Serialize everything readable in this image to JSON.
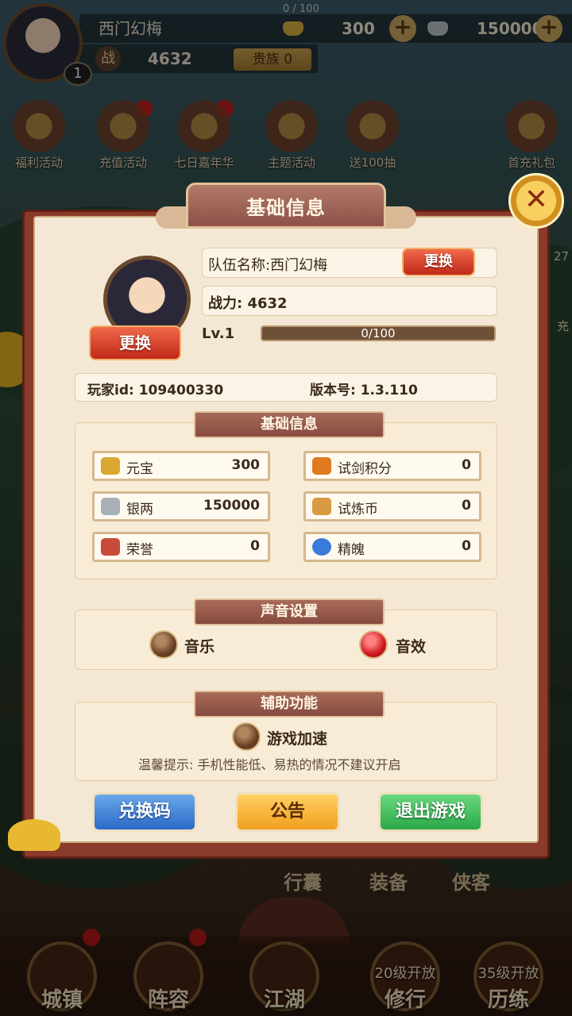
{
  "hud": {
    "player_name": "西门幻梅",
    "level": "1",
    "exp": "0 / 100",
    "gold": "300",
    "silver": "150000",
    "plus": "+",
    "power_icon": "战",
    "power": "4632",
    "noble": "贵族 0"
  },
  "activities": [
    {
      "label": "福利活动"
    },
    {
      "label": "充值活动"
    },
    {
      "label": "七日嘉年华"
    },
    {
      "label": "主题活动"
    },
    {
      "label": "送100抽"
    },
    {
      "label": "首充礼包"
    }
  ],
  "side": {
    "right_num": "27",
    "right_char": "充"
  },
  "mid_nav": [
    "行囊",
    "装备",
    "侠客"
  ],
  "bottom_nav": [
    {
      "label": "城镇",
      "lock": ""
    },
    {
      "label": "阵容",
      "lock": ""
    },
    {
      "label": "江湖",
      "lock": ""
    },
    {
      "label": "修行",
      "lock": "20级开放"
    },
    {
      "label": "历练",
      "lock": "35级开放"
    }
  ],
  "dialog": {
    "title": "基础信息",
    "close_icon": "✕",
    "avatar_change": "更换",
    "team_name": "队伍名称:西门幻梅",
    "name_change": "更换",
    "power": "战力: 4632",
    "level": "Lv.1",
    "exp_text": "0/100",
    "exp_fraction": 0,
    "player_id": "玩家id: 109400330",
    "version": "版本号: 1.3.110",
    "basic_section": "基础信息",
    "resources": [
      {
        "name": "元宝",
        "value": "300",
        "color": "#d8a830"
      },
      {
        "name": "试剑积分",
        "value": "0",
        "color": "#e07a20"
      },
      {
        "name": "银两",
        "value": "150000",
        "color": "#a8b0b8"
      },
      {
        "name": "试炼币",
        "value": "0",
        "color": "#d89a40"
      },
      {
        "name": "荣誉",
        "value": "0",
        "color": "#c84a3a"
      },
      {
        "name": "精魄",
        "value": "0",
        "color": "#3a7ad8"
      }
    ],
    "sound_section": "声音设置",
    "music": "音乐",
    "sfx": "音效",
    "assist_section": "辅助功能",
    "speedup": "游戏加速",
    "tip": "温馨提示: 手机性能低、易热的情况不建议开启",
    "redeem": "兑换码",
    "notice": "公告",
    "quit": "退出游戏"
  }
}
